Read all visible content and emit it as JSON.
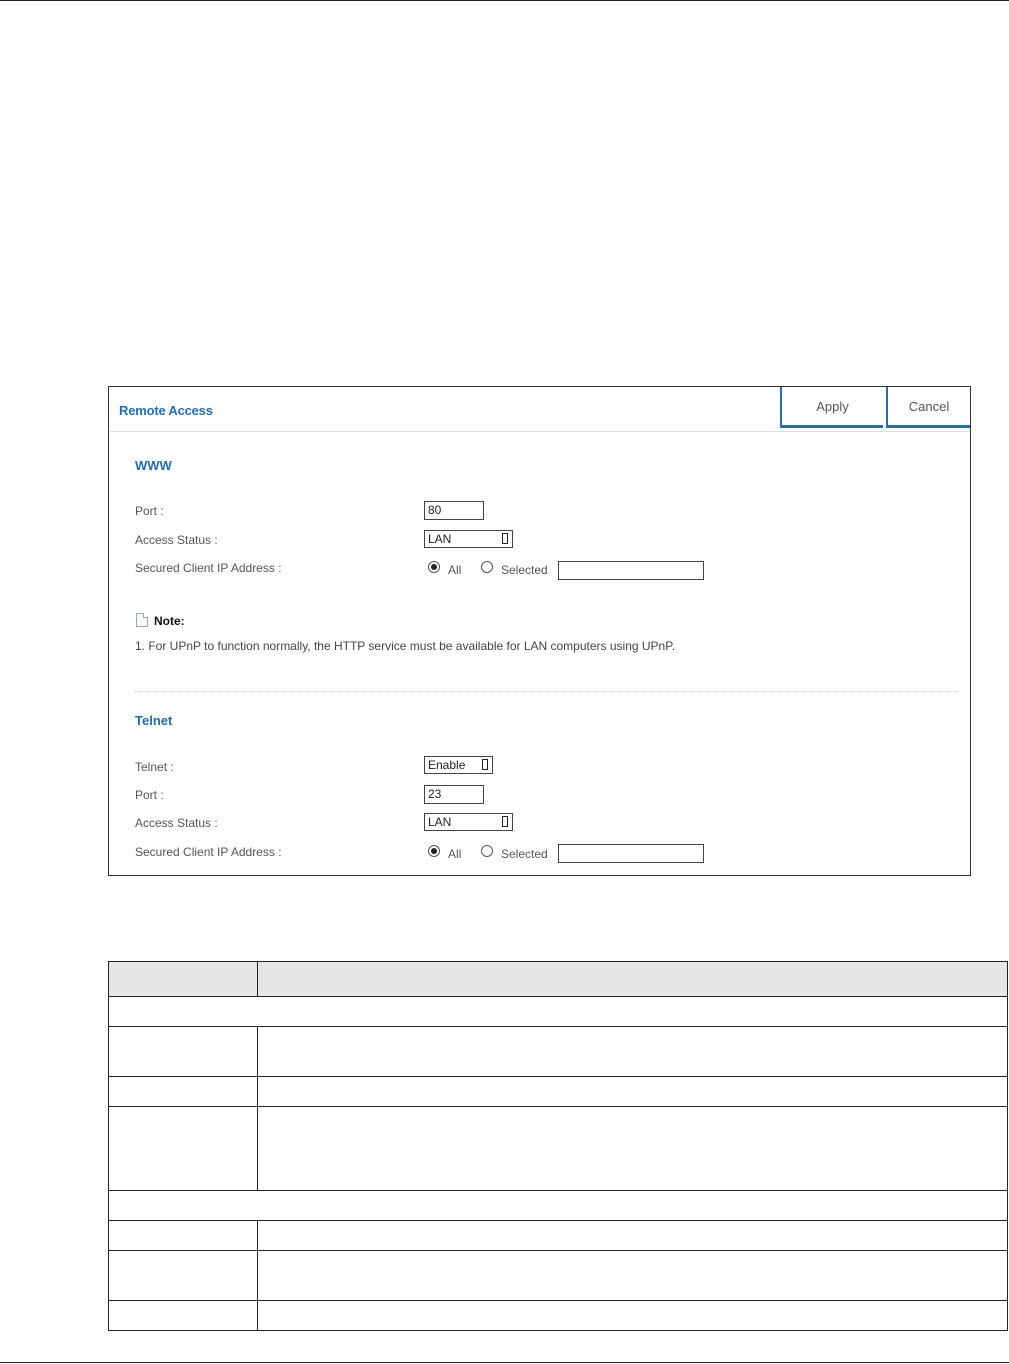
{
  "panel": {
    "title": "Remote Access",
    "apply_label": "Apply",
    "cancel_label": "Cancel"
  },
  "www": {
    "section_title": "WWW",
    "port_label": "Port :",
    "port_value": "80",
    "access_status_label": "Access Status :",
    "access_status_value": "LAN",
    "secured_client_label": "Secured Client IP Address :",
    "radio_all": "All",
    "radio_selected": "Selected",
    "selected_ip_value": ""
  },
  "note": {
    "title": "Note:",
    "text": "1. For UPnP to function normally, the HTTP service must be available for LAN computers using UPnP."
  },
  "telnet": {
    "section_title": "Telnet",
    "telnet_label": "Telnet :",
    "telnet_value": "Enable",
    "port_label": "Port :",
    "port_value": "23",
    "access_status_label": "Access Status :",
    "access_status_value": "LAN",
    "secured_client_label": "Secured Client IP Address :",
    "radio_all": "All",
    "radio_selected": "Selected",
    "selected_ip_value": ""
  }
}
